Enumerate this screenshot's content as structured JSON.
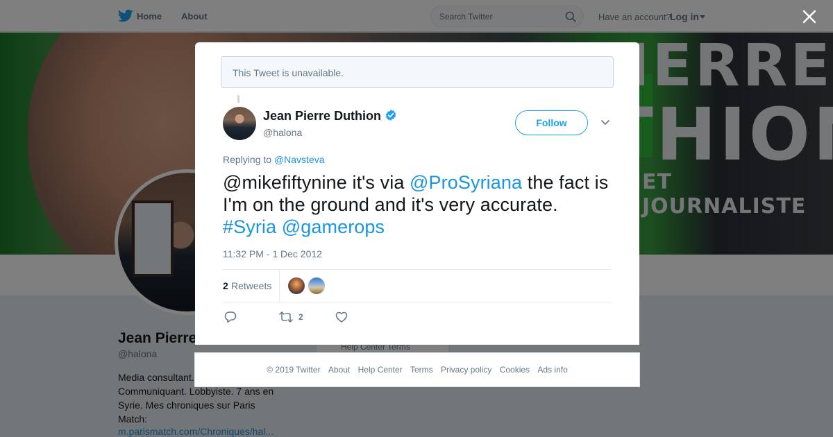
{
  "topnav": {
    "home_label": "Home",
    "about_label": "About",
    "search_placeholder": "Search Twitter",
    "have_account": "Have an account?",
    "login_label": "Log in"
  },
  "banner": {
    "line1": "JEAN-PIERRE",
    "line2": "THION",
    "line3": "ET JOURNALISTE"
  },
  "profile": {
    "name": "Jean Pierre",
    "handle": "@halona",
    "bio": "Media consultant. Entrepreneur. Communiquant. Lobbyiste. 7 ans en Syrie. Mes chroniques sur Paris Match:",
    "link": "m.parismatch.com/Chroniques/hal..."
  },
  "bg_footer_snip": "Help Center   Terms",
  "modal": {
    "unavailable_notice": "This Tweet is unavailable.",
    "author": {
      "name": "Jean Pierre Duthion",
      "handle": "@halona",
      "verified": true
    },
    "follow_label": "Follow",
    "replying_prefix": "Replying to",
    "replying_to": "@Navsteva",
    "tweet": {
      "part1": "@mikefiftynine it's via ",
      "mention1": "@ProSyriana",
      "part2": " the fact is I'm on the ground and it's very accurate. ",
      "hashtag": "#Syria",
      "space": " ",
      "mention2": "@gamerops"
    },
    "timestamp": "11:32 PM - 1 Dec 2012",
    "stats": {
      "retweet_count": "2",
      "retweet_label": "Retweets"
    },
    "actions": {
      "retweet_count": "2"
    }
  },
  "footer": {
    "copyright": "© 2019 Twitter",
    "about": "About",
    "help": "Help Center",
    "terms": "Terms",
    "privacy": "Privacy policy",
    "cookies": "Cookies",
    "ads": "Ads info"
  },
  "colors": {
    "twitter_blue": "#1da1f2",
    "link_blue": "#1b95e0",
    "muted_text": "#657786",
    "text": "#14171a"
  }
}
